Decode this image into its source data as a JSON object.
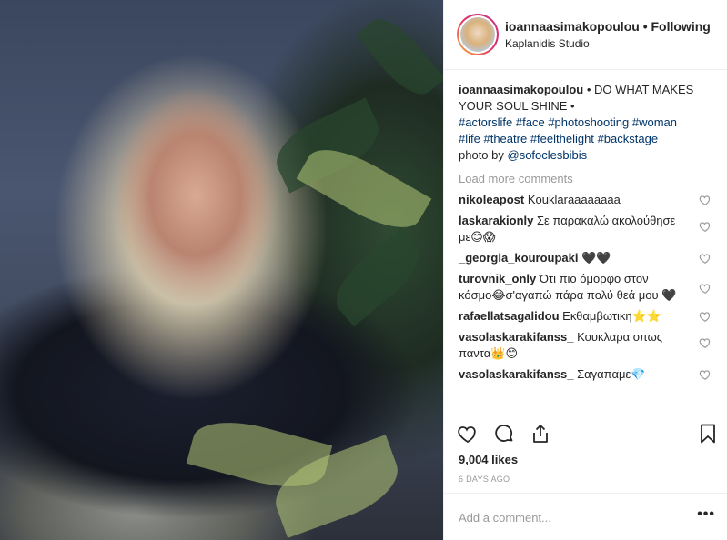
{
  "post": {
    "image_alt": "photo",
    "header": {
      "username": "ioannaasimakopoulou",
      "separator": "•",
      "follow_label": "Following",
      "location": "Kaplanidis Studio"
    },
    "caption": {
      "username": "ioannaasimakopoulou",
      "text": "• DO WHAT MAKES YOUR SOUL SHINE •",
      "hashtags": [
        "#actorslife",
        "#face",
        "#photoshooting",
        "#woman",
        "#life",
        "#theatre",
        "#feelthelight",
        "#backstage"
      ],
      "photo_by_prefix": "photo by",
      "photo_by_mention": "@sofoclesbibis"
    },
    "load_more_label": "Load more comments",
    "comments": [
      {
        "user": "nikoleapost",
        "text": "Kouklaraaaaaaaa"
      },
      {
        "user": "laskarakionly",
        "text": "Σε παρακαλώ ακολούθησε με😊😱"
      },
      {
        "user": "_georgia_kouroupaki",
        "text": "🖤🖤"
      },
      {
        "user": "turovnik_only",
        "text": "Ότι πιο όμορφο στον κόσμο😂σ'αγαπώ πάρα πολύ θεά μου 🖤"
      },
      {
        "user": "rafaellatsagalidou",
        "text": "Εκθαμβωτικη⭐⭐"
      },
      {
        "user": "vasolaskarakifanss_",
        "text": "Κουκλαρα οπως παντα👑😊"
      },
      {
        "user": "vasolaskarakifanss_",
        "text": "Σαγαπαμε💎"
      }
    ],
    "likes": "9,004 likes",
    "time": "6 DAYS AGO",
    "add_comment_placeholder": "Add a comment...",
    "more_options": "•••"
  },
  "icons": {
    "like": "heart-icon",
    "comment": "comment-icon",
    "share": "share-icon",
    "save": "bookmark-icon",
    "comment_like": "heart-icon"
  },
  "colors": {
    "hashtag": "#003569",
    "muted": "#999999",
    "text": "#262626",
    "border": "#efefef"
  }
}
